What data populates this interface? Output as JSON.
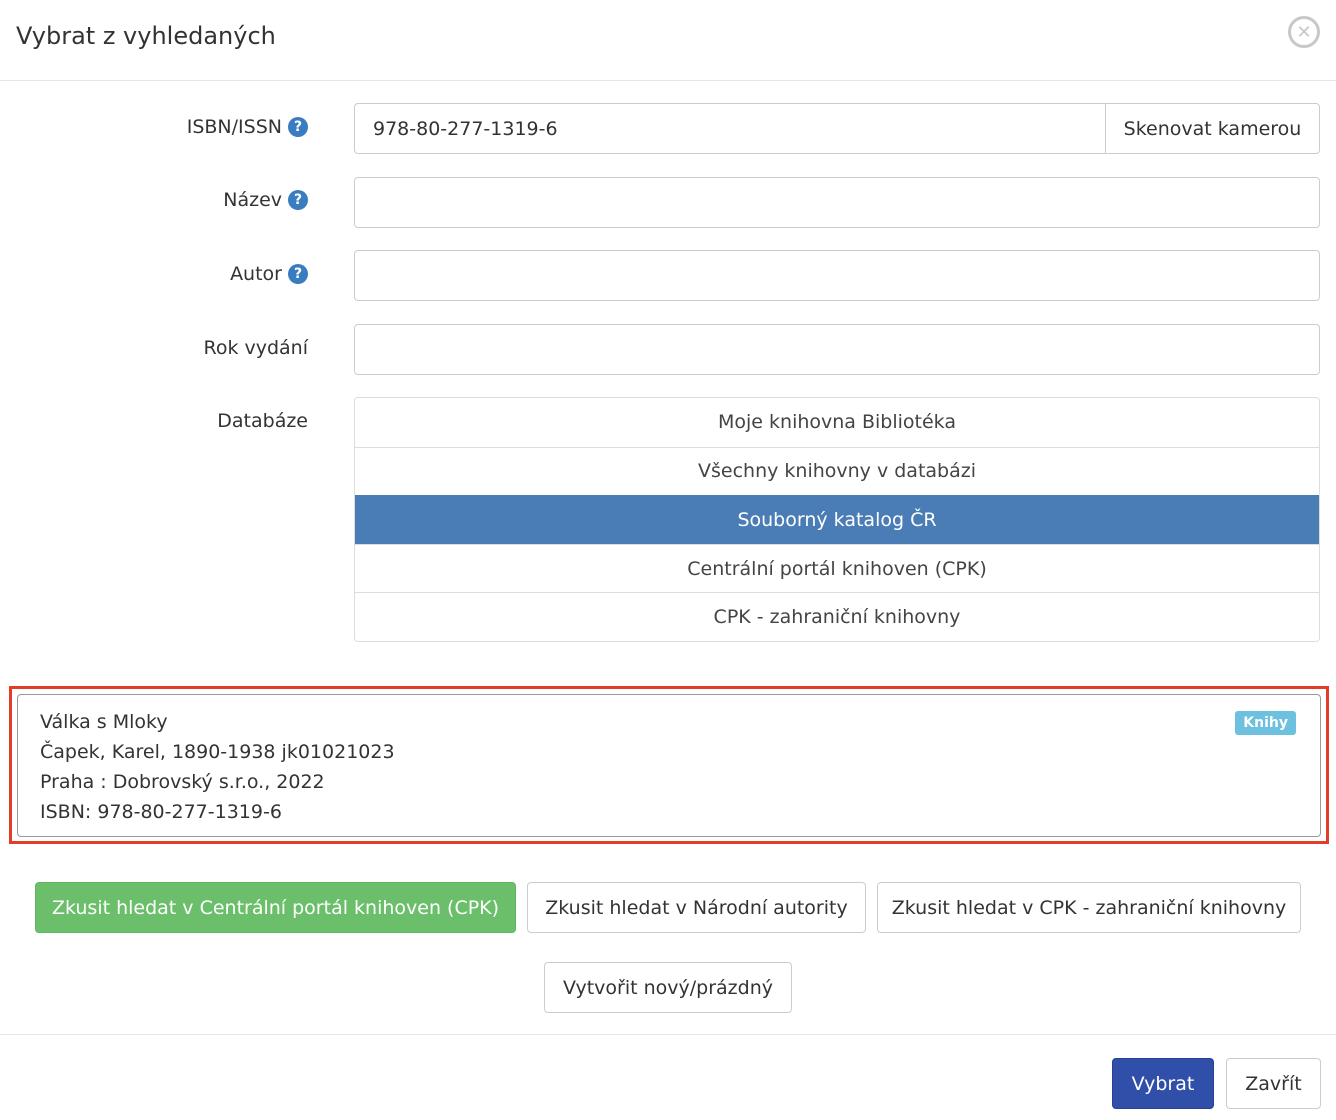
{
  "dialog": {
    "title": "Vybrat z vyhledaných",
    "close_icon": "close-circle-icon"
  },
  "form": {
    "isbn": {
      "label": "ISBN/ISSN",
      "value": "978-80-277-1319-6",
      "scan_button": "Skenovat kamerou"
    },
    "title": {
      "label": "Název",
      "value": ""
    },
    "author": {
      "label": "Autor",
      "value": ""
    },
    "year": {
      "label": "Rok vydání",
      "value": ""
    },
    "database": {
      "label": "Databáze",
      "items": [
        {
          "label": "Moje knihovna Bibliotéka"
        },
        {
          "label": "Všechny knihovny v databázi"
        },
        {
          "label": "Souborný katalog ČR",
          "selected": true
        },
        {
          "label": "Centrální portál knihoven (CPK)"
        },
        {
          "label": "CPK - zahraniční knihovny"
        }
      ]
    }
  },
  "result": {
    "title": "Válka s Mloky",
    "author": "Čapek, Karel, 1890-1938 jk01021023",
    "publisher": "Praha : Dobrovský s.r.o., 2022",
    "isbn": "ISBN: 978-80-277-1319-6",
    "badge": "Knihy"
  },
  "actions": {
    "try_cpk": "Zkusit hledat v Centrální portál knihoven (CPK)",
    "try_authorities": "Zkusit hledat v Národní autority",
    "try_cpk_foreign": "Zkusit hledat v CPK - zahraniční knihovny",
    "create_new": "Vytvořit nový/prázdný"
  },
  "footer": {
    "select": "Vybrat",
    "close": "Zavřít"
  },
  "colors": {
    "accent_selected": "#4a7db5",
    "success": "#6bbf6b",
    "primary": "#2f4fa8",
    "highlight": "#e23c2a",
    "badge": "#6ec0df"
  }
}
